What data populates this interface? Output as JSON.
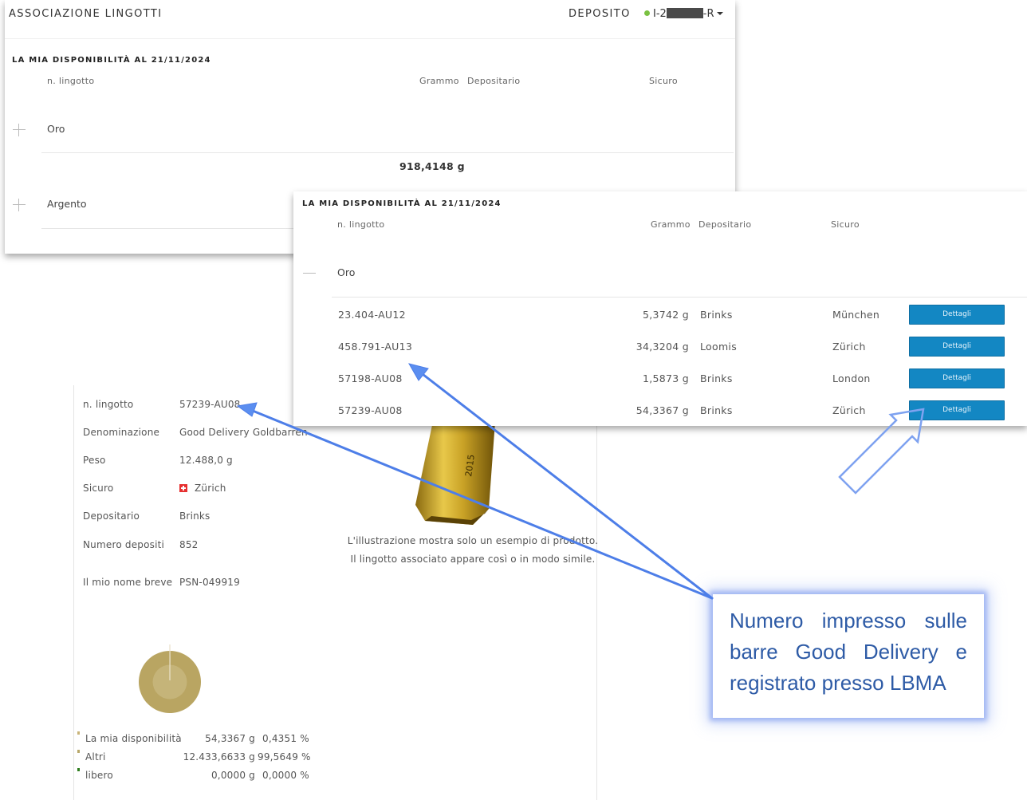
{
  "header": {
    "brand": "ASSOCIAZIONE LINGOTTI",
    "deposit_label": "DEPOSITO",
    "account_prefix": "I-2",
    "account_suffix": "-R"
  },
  "summary": {
    "section_title": "LA MIA DISPONIBILITÀ AL 21/11/2024",
    "columns": {
      "bar_number": "n. lingotto",
      "grams": "Grammo",
      "custodian": "Depositario",
      "vault": "Sicuro"
    },
    "groups": [
      {
        "name": "Oro",
        "total": "918,4148 g"
      },
      {
        "name": "Argento"
      }
    ]
  },
  "detail_list": {
    "section_title": "LA MIA DISPONIBILITÀ AL 21/11/2024",
    "columns": {
      "bar_number": "n. lingotto",
      "grams": "Grammo",
      "custodian": "Depositario",
      "vault": "Sicuro"
    },
    "group": "Oro",
    "button_label": "Dettagli",
    "rows": [
      {
        "bar": "23.404-AU12",
        "grams": "5,3742 g",
        "custodian": "Brinks",
        "vault": "München"
      },
      {
        "bar": "458.791-AU13",
        "grams": "34,3204 g",
        "custodian": "Loomis",
        "vault": "Zürich"
      },
      {
        "bar": "57198-AU08",
        "grams": "1,5873 g",
        "custodian": "Brinks",
        "vault": "London"
      },
      {
        "bar": "57239-AU08",
        "grams": "54,3367 g",
        "custodian": "Brinks",
        "vault": "Zürich"
      }
    ]
  },
  "bar_detail": {
    "fields": [
      {
        "label": "n. lingotto",
        "value": "57239-AU08"
      },
      {
        "label": "Denominazione",
        "value": "Good Delivery Goldbarren"
      },
      {
        "label": "Peso",
        "value": "12.488,0 g"
      },
      {
        "label": "Sicuro",
        "value": "Zürich"
      },
      {
        "label": "Depositario",
        "value": "Brinks"
      },
      {
        "label": "Numero depositi",
        "value": "852"
      },
      {
        "label": "Il mio nome breve",
        "value": "PSN-049919"
      }
    ],
    "bar_year": "2015",
    "caption_line1": "L'illustrazione mostra solo un esempio di prodotto.",
    "caption_line2": "Il lingotto associato appare così o in modo simile.",
    "share": [
      {
        "label": "La mia disponibilità",
        "grams": "54,3367 g",
        "percent": "0,4351 %",
        "fraction": 0.004351,
        "color": "#c9b479"
      },
      {
        "label": "Altri",
        "grams": "12.433,6633 g",
        "percent": "99,5649 %",
        "fraction": 0.995649,
        "color": "#b8a86a"
      },
      {
        "label": "libero",
        "grams": "0,0000 g",
        "percent": "0,0000 %",
        "fraction": 0.0,
        "color": "#2e7d1e"
      }
    ]
  },
  "callout": {
    "text": "Numero impresso sulle barre Good Delivery e registrato presso LBMA",
    "color": "#2e5ba6"
  },
  "colors": {
    "button": "#1387c3",
    "online_dot": "#7ac142",
    "arrow": "#5b8ef0"
  }
}
